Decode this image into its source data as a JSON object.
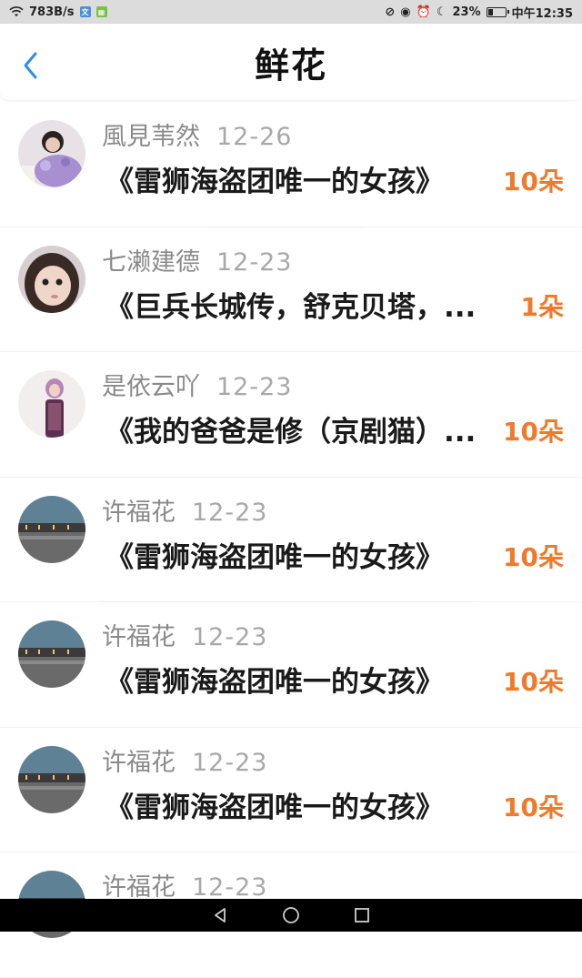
{
  "status_bar": {
    "net_speed": "783B/s",
    "battery_percent": "23%",
    "time": "中午12:35"
  },
  "header": {
    "title": "鲜花"
  },
  "rows": [
    {
      "user": "風見苇然",
      "date": "12-26",
      "title": "《雷狮海盗团唯一的女孩》",
      "count": "10朵"
    },
    {
      "user": "七濑建德",
      "date": "12-23",
      "title": "《巨兵长城传，舒克贝塔，...",
      "count": "1朵"
    },
    {
      "user": "是依云吖",
      "date": "12-23",
      "title": "《我的爸爸是修（京剧猫）...",
      "count": "10朵"
    },
    {
      "user": "许福花",
      "date": "12-23",
      "title": "《雷狮海盗团唯一的女孩》",
      "count": "10朵"
    },
    {
      "user": "许福花",
      "date": "12-23",
      "title": "《雷狮海盗团唯一的女孩》",
      "count": "10朵"
    },
    {
      "user": "许福花",
      "date": "12-23",
      "title": "《雷狮海盗团唯一的女孩》",
      "count": "10朵"
    },
    {
      "user": "许福花",
      "date": "12-23",
      "title": "",
      "count": ""
    }
  ]
}
